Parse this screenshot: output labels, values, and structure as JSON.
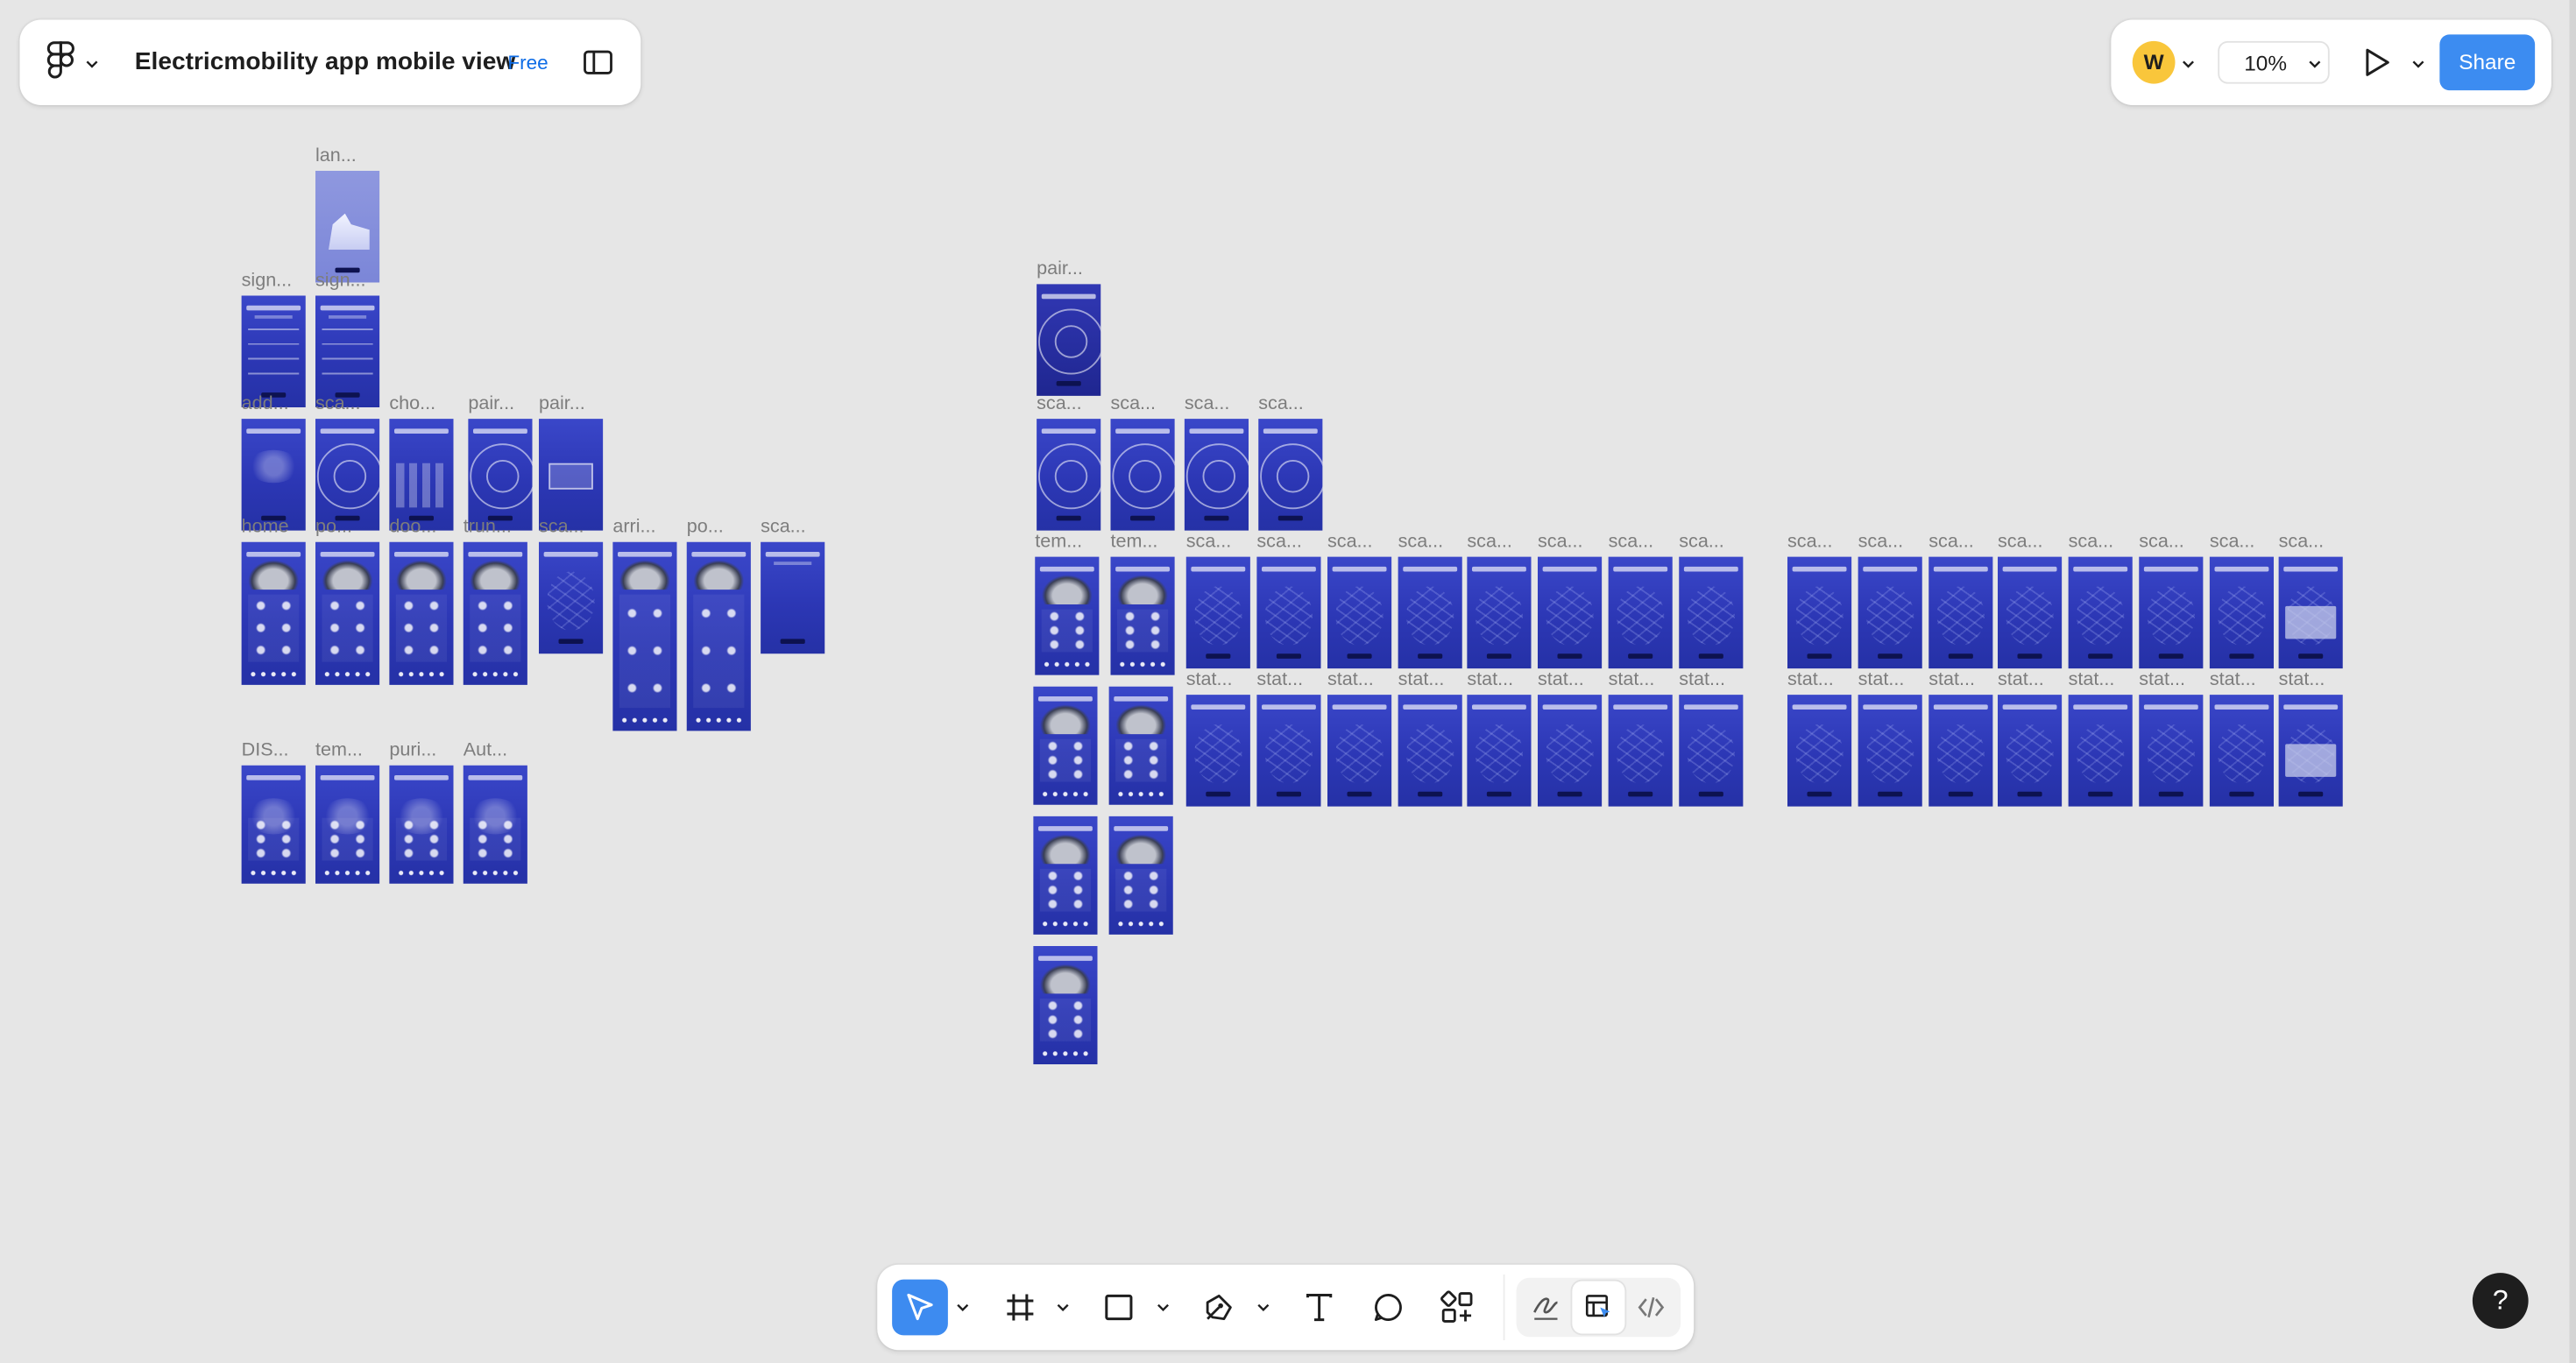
{
  "file": {
    "title": "Electricmobility app mobile view",
    "plan_badge": "Free"
  },
  "user": {
    "avatar_initial": "W"
  },
  "zoom": {
    "value": "10%"
  },
  "share_label": "Share",
  "help_label": "?",
  "colors": {
    "accent": "#3c8cf1",
    "frame_blue": "#2c37b5",
    "avatar": "#f9c63b",
    "canvas": "#e6e6e6"
  },
  "toolbar": {
    "tools": [
      "move-tool",
      "frame-tool",
      "shape-tool",
      "pen-tool",
      "text-tool",
      "comment-tool",
      "actions-tool"
    ],
    "modes": [
      "draw-mode",
      "design-mode",
      "dev-mode"
    ]
  },
  "frames": [
    {
      "label": "lan...",
      "kind": "house"
    },
    {
      "label": "sign...",
      "kind": "sign"
    },
    {
      "label": "sign...",
      "kind": "sign"
    },
    {
      "label": "add...",
      "kind": "glow"
    },
    {
      "label": "sca...",
      "kind": "ring"
    },
    {
      "label": "cho...",
      "kind": "cars"
    },
    {
      "label": "pair...",
      "kind": "ring"
    },
    {
      "label": "pair...",
      "kind": "paired"
    },
    {
      "label": "home",
      "kind": "dash"
    },
    {
      "label": "po...",
      "kind": "dash"
    },
    {
      "label": "doo...",
      "kind": "dash"
    },
    {
      "label": "trun...",
      "kind": "dash"
    },
    {
      "label": "sca...",
      "kind": "map"
    },
    {
      "label": "arri...",
      "kind": "dash"
    },
    {
      "label": "po...",
      "kind": "dash"
    },
    {
      "label": "sca...",
      "kind": "plain"
    },
    {
      "label": "DIS...",
      "kind": "grid"
    },
    {
      "label": "tem...",
      "kind": "grid"
    },
    {
      "label": "puri...",
      "kind": "grid"
    },
    {
      "label": "Aut...",
      "kind": "grid"
    },
    {
      "label": "pair...",
      "kind": "ring"
    },
    {
      "label": "sca...",
      "kind": "ring"
    },
    {
      "label": "sca...",
      "kind": "ring"
    },
    {
      "label": "sca...",
      "kind": "ring"
    },
    {
      "label": "sca...",
      "kind": "ring"
    },
    {
      "label": "tem...",
      "kind": "dash"
    },
    {
      "label": "tem...",
      "kind": "dash"
    },
    {
      "label": "sca...",
      "kind": "map"
    },
    {
      "label": "sca...",
      "kind": "map"
    },
    {
      "label": "sca...",
      "kind": "map"
    },
    {
      "label": "sca...",
      "kind": "map"
    },
    {
      "label": "sca...",
      "kind": "map"
    },
    {
      "label": "sca...",
      "kind": "map"
    },
    {
      "label": "sca...",
      "kind": "map"
    },
    {
      "label": "sca...",
      "kind": "map"
    },
    {
      "label": "sca...",
      "kind": "map"
    },
    {
      "label": "sca...",
      "kind": "map"
    },
    {
      "label": "sca...",
      "kind": "map"
    },
    {
      "label": "sca...",
      "kind": "map"
    },
    {
      "label": "sca...",
      "kind": "map"
    },
    {
      "label": "sca...",
      "kind": "map"
    },
    {
      "label": "sca...",
      "kind": "map"
    },
    {
      "label": "sca...",
      "kind": "popup"
    },
    {
      "label": "",
      "kind": "dash"
    },
    {
      "label": "",
      "kind": "dash"
    },
    {
      "label": "stat...",
      "kind": "map"
    },
    {
      "label": "stat...",
      "kind": "map"
    },
    {
      "label": "stat...",
      "kind": "map"
    },
    {
      "label": "stat...",
      "kind": "map"
    },
    {
      "label": "stat...",
      "kind": "map"
    },
    {
      "label": "stat...",
      "kind": "map"
    },
    {
      "label": "stat...",
      "kind": "map"
    },
    {
      "label": "stat...",
      "kind": "map"
    },
    {
      "label": "stat...",
      "kind": "map"
    },
    {
      "label": "stat...",
      "kind": "map"
    },
    {
      "label": "stat...",
      "kind": "map"
    },
    {
      "label": "stat...",
      "kind": "map"
    },
    {
      "label": "stat...",
      "kind": "map"
    },
    {
      "label": "stat...",
      "kind": "map"
    },
    {
      "label": "stat...",
      "kind": "map"
    },
    {
      "label": "stat...",
      "kind": "popup"
    },
    {
      "label": "",
      "kind": "dash"
    },
    {
      "label": "",
      "kind": "dash"
    },
    {
      "label": "",
      "kind": "dash"
    }
  ]
}
